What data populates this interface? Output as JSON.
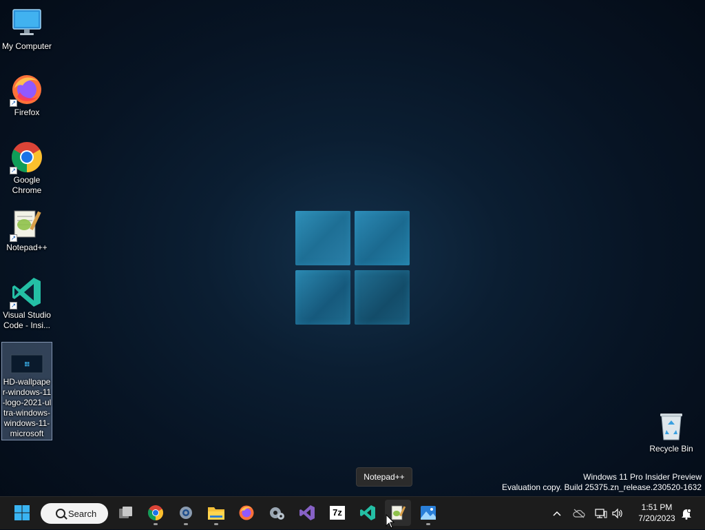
{
  "desktop": {
    "icons": [
      {
        "label": "My Computer"
      },
      {
        "label": "Firefox"
      },
      {
        "label": "Google Chrome"
      },
      {
        "label": "Notepad++"
      },
      {
        "label": "Visual Studio Code - Insi..."
      },
      {
        "label": "HD-wallpaper-windows-11-logo-2021-ultra-windows-windows-11-microsoft"
      }
    ],
    "recycle_bin": {
      "label": "Recycle Bin"
    }
  },
  "watermark": {
    "line1": "Windows 11 Pro Insider Preview",
    "line2": "Evaluation copy. Build 25375.zn_release.230520-1632"
  },
  "tooltip": {
    "text": "Notepad++"
  },
  "taskbar": {
    "search_label": "Search",
    "apps": [
      {
        "name": "start-icon"
      },
      {
        "name": "task-view-icon"
      },
      {
        "name": "chrome-icon"
      },
      {
        "name": "settings-gear-icon"
      },
      {
        "name": "file-explorer-icon"
      },
      {
        "name": "firefox-icon"
      },
      {
        "name": "control-settings-icon"
      },
      {
        "name": "visual-studio-icon"
      },
      {
        "name": "7zip-icon"
      },
      {
        "name": "vscode-insiders-icon"
      },
      {
        "name": "notepad-plus-plus-icon"
      },
      {
        "name": "photos-icon"
      }
    ],
    "sevenzip_label": "7z",
    "clock": {
      "time": "1:51 PM",
      "date": "7/20/2023"
    }
  },
  "colors": {
    "taskbar_bg": "#1c1c1c",
    "accent_blue": "#1a9fe0",
    "desktop_bg": "#0b1e32"
  }
}
